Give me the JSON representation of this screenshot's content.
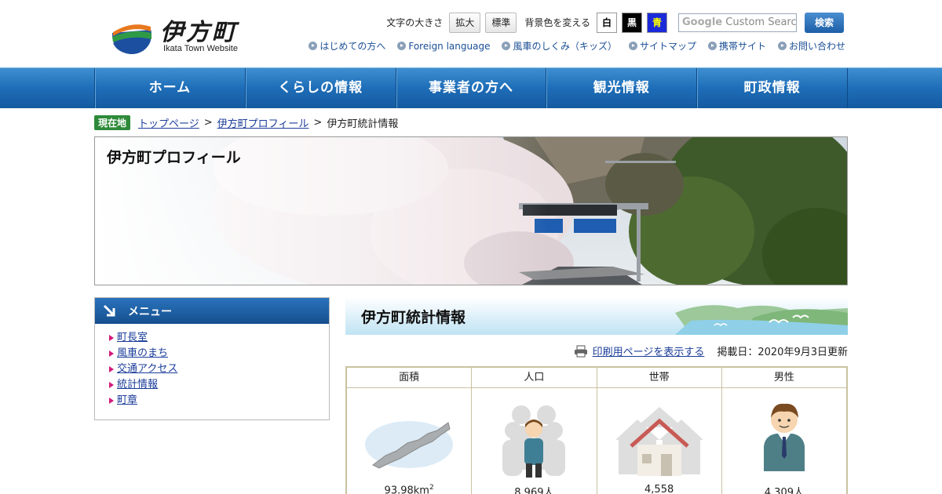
{
  "header": {
    "logo_text": "伊方町",
    "logo_sub": "Ikata Town Website",
    "text_size_label": "文字の大きさ",
    "enlarge_label": "拡大",
    "standard_label": "標準",
    "bg_label": "背景色を変える",
    "bg_white": "白",
    "bg_black": "黒",
    "bg_blue": "青",
    "search_placeholder": "Custom Searc",
    "search_brand": "Google",
    "search_button": "検索",
    "sublinks": [
      "はじめての方へ",
      "Foreign language",
      "風車のしくみ（キッズ）",
      "サイトマップ",
      "携帯サイト",
      "お問い合わせ"
    ]
  },
  "nav": [
    "ホーム",
    "くらしの情報",
    "事業者の方へ",
    "観光情報",
    "町政情報"
  ],
  "breadcrumb": {
    "tag": "現在地",
    "items": [
      "トップページ",
      "伊方町プロフィール",
      "伊方町統計情報"
    ],
    "separator": ">"
  },
  "hero": {
    "title": "伊方町プロフィール"
  },
  "sidemenu": {
    "title": "メニュー",
    "items": [
      "町長室",
      "風車のまち",
      "交通アクセス",
      "統計情報",
      "町章"
    ]
  },
  "main": {
    "title": "伊方町統計情報",
    "print_link": "印刷用ページを表示する",
    "updated": "掲載日：2020年9月3日更新",
    "stats": [
      {
        "label": "面積",
        "value": "93.98km",
        "sup": "2",
        "icon": "peninsula-map-icon"
      },
      {
        "label": "人口",
        "value": "8,969人",
        "icon": "population-icon"
      },
      {
        "label": "世帯",
        "value": "4,558",
        "icon": "house-icon"
      },
      {
        "label": "男性",
        "value": "4,309人",
        "icon": "man-icon"
      }
    ]
  },
  "colors": {
    "nav_blue": "#1e6db8",
    "link": "#1b3d9a",
    "crumb_tag": "#2e8a3a",
    "accent_pink": "#d4197a"
  }
}
